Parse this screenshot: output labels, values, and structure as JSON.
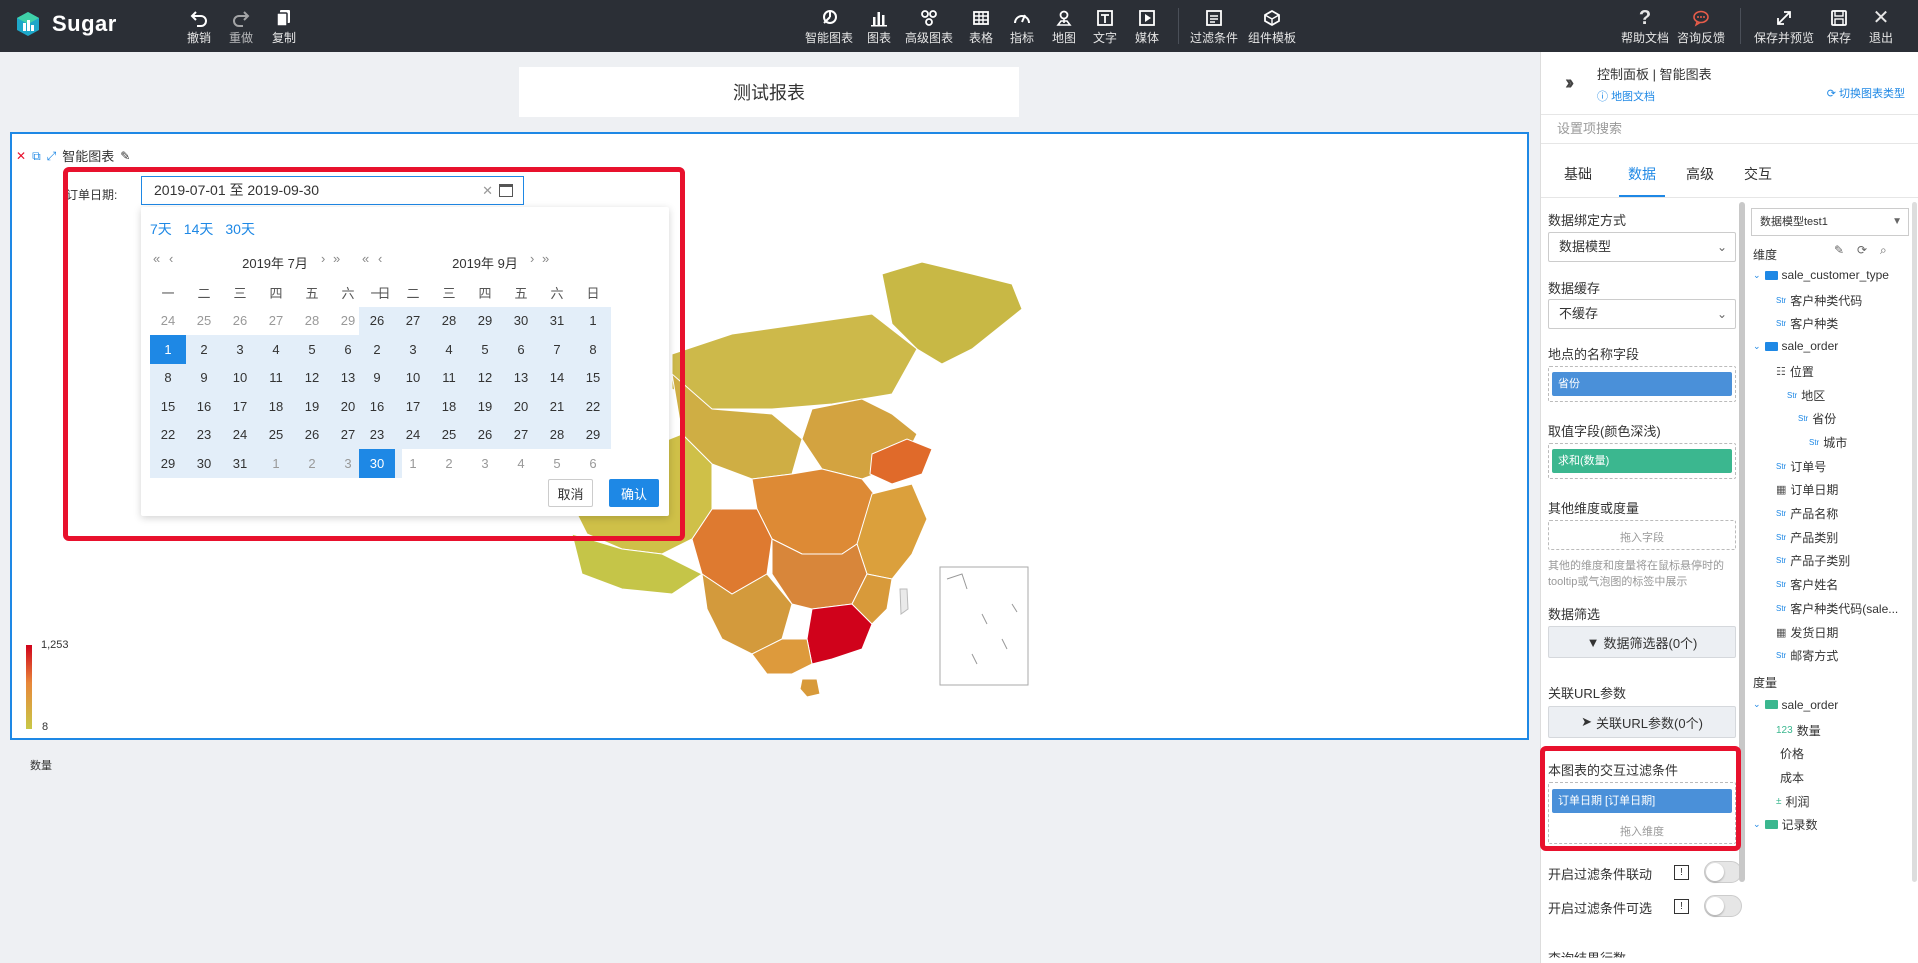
{
  "app": {
    "name": "Sugar"
  },
  "toolbar": {
    "left": [
      {
        "label": "撤销",
        "icon": "undo-icon"
      },
      {
        "label": "重做",
        "icon": "redo-icon"
      },
      {
        "label": "复制",
        "icon": "copy-icon"
      }
    ],
    "center": [
      {
        "label": "智能图表",
        "icon": "smart-chart-icon"
      },
      {
        "label": "图表",
        "icon": "bar-chart-icon"
      },
      {
        "label": "高级图表",
        "icon": "advanced-chart-icon"
      },
      {
        "label": "表格",
        "icon": "table-icon"
      },
      {
        "label": "指标",
        "icon": "gauge-icon"
      },
      {
        "label": "地图",
        "icon": "map-pin-icon"
      },
      {
        "label": "文字",
        "icon": "text-icon"
      },
      {
        "label": "媒体",
        "icon": "media-icon"
      },
      {
        "label": "过滤条件",
        "icon": "filter-condition-icon"
      },
      {
        "label": "组件模板",
        "icon": "component-template-icon"
      }
    ],
    "right": [
      {
        "label": "帮助文档",
        "icon": "help-icon"
      },
      {
        "label": "咨询反馈",
        "icon": "feedback-icon"
      },
      {
        "label": "保存并预览",
        "icon": "save-preview-icon"
      },
      {
        "label": "保存",
        "icon": "save-icon"
      },
      {
        "label": "退出",
        "icon": "close-icon"
      }
    ],
    "feedback_color": "#e85d4a"
  },
  "report": {
    "title": "测试报表"
  },
  "chart": {
    "name": "智能图表",
    "filter_label": "订单日期:",
    "date_value": "2019-07-01 至 2019-09-30",
    "clear_glyph": "✕",
    "legend": {
      "title": "数量",
      "max": "1,253",
      "min": "8"
    }
  },
  "datepicker": {
    "shortcuts": [
      "7天",
      "14天",
      "30天"
    ],
    "weekdays": [
      "一",
      "二",
      "三",
      "四",
      "五",
      "六",
      "日"
    ],
    "left": {
      "title": "2019年 7月",
      "days": [
        "24",
        "25",
        "26",
        "27",
        "28",
        "29",
        "30",
        "1",
        "2",
        "3",
        "4",
        "5",
        "6",
        "7",
        "8",
        "9",
        "10",
        "11",
        "12",
        "13",
        "14",
        "15",
        "16",
        "17",
        "18",
        "19",
        "20",
        "21",
        "22",
        "23",
        "24",
        "25",
        "26",
        "27",
        "28",
        "29",
        "30",
        "31",
        "1",
        "2",
        "3",
        "4"
      ]
    },
    "right": {
      "title": "2019年 9月",
      "days": [
        "26",
        "27",
        "28",
        "29",
        "30",
        "31",
        "1",
        "2",
        "3",
        "4",
        "5",
        "6",
        "7",
        "8",
        "9",
        "10",
        "11",
        "12",
        "13",
        "14",
        "15",
        "16",
        "17",
        "18",
        "19",
        "20",
        "21",
        "22",
        "23",
        "24",
        "25",
        "26",
        "27",
        "28",
        "29",
        "30",
        "1",
        "2",
        "3",
        "4",
        "5",
        "6"
      ]
    },
    "cancel": "取消",
    "confirm": "确认",
    "accent": "#1e88e5",
    "range_bg": "#e3eef9"
  },
  "panel": {
    "title": "控制面板 | 智能图表",
    "doc_link": "地图文档",
    "switch_link": "切换图表类型",
    "search_placeholder": "设置项搜索",
    "tabs": [
      "基础",
      "数据",
      "高级",
      "交互"
    ],
    "active_tab": "数据",
    "bind_mode_label": "数据绑定方式",
    "bind_mode_value": "数据模型",
    "cache_label": "数据缓存",
    "cache_value": "不缓存",
    "location_label": "地点的名称字段",
    "location_field": "省份",
    "value_label": "取值字段(颜色深浅)",
    "value_field": "求和(数量)",
    "other_label": "其他维度或度量",
    "drop_field": "拖入字段",
    "other_note": "其他的维度和度量将在鼠标悬停时的tooltip或气泡图的标签中展示",
    "filter_label": "数据筛选",
    "filter_button": "数据筛选器(0个)",
    "url_label": "关联URL参数",
    "url_button": "关联URL参数(0个)",
    "interact_label": "本图表的交互过滤条件",
    "interact_field": "订单日期 [订单日期]",
    "drop_dim": "拖入维度",
    "toggle1": "开启过滤条件联动",
    "toggle2": "开启过滤条件可选",
    "info_glyph": "!",
    "cut_label": "查询结果行数",
    "field_blue": "#4a90d9",
    "field_green": "#3bb78f"
  },
  "model": {
    "selected": "数据模型test1",
    "dim_label": "维度",
    "measure_label": "度量",
    "dimensions": [
      {
        "level": 0,
        "kind": "folder",
        "label": "sale_customer_type"
      },
      {
        "level": 1,
        "kind": "Str",
        "label": "客户种类代码"
      },
      {
        "level": 1,
        "kind": "Str",
        "label": "客户种类"
      },
      {
        "level": 0,
        "kind": "folder",
        "label": "sale_order"
      },
      {
        "level": 1,
        "kind": "hier",
        "label": "位置"
      },
      {
        "level": 2,
        "kind": "Str",
        "label": "地区"
      },
      {
        "level": 3,
        "kind": "Str",
        "label": "省份"
      },
      {
        "level": 4,
        "kind": "Str",
        "label": "城市"
      },
      {
        "level": 1,
        "kind": "Str",
        "label": "订单号"
      },
      {
        "level": 1,
        "kind": "date",
        "label": "订单日期"
      },
      {
        "level": 1,
        "kind": "Str",
        "label": "产品名称"
      },
      {
        "level": 1,
        "kind": "Str",
        "label": "产品类别"
      },
      {
        "level": 1,
        "kind": "Str",
        "label": "产品子类别"
      },
      {
        "level": 1,
        "kind": "Str",
        "label": "客户姓名"
      },
      {
        "level": 1,
        "kind": "Str",
        "label": "客户种类代码(sale..."
      },
      {
        "level": 1,
        "kind": "date",
        "label": "发货日期"
      },
      {
        "level": 1,
        "kind": "Str",
        "label": "邮寄方式"
      }
    ],
    "measures": [
      {
        "level": 0,
        "kind": "folder",
        "label": "sale_order"
      },
      {
        "level": 1,
        "kind": "123",
        "label": "数量"
      },
      {
        "level": 1,
        "kind": "0.5",
        "label": "价格"
      },
      {
        "level": 1,
        "kind": "0.5",
        "label": "成本"
      },
      {
        "level": 1,
        "kind": "calc",
        "label": "利润"
      },
      {
        "level": 0,
        "kind": "folder",
        "label": "记录数"
      }
    ],
    "tag_texts": {
      "Str": "Str",
      "123": "123",
      "0.5": "0.5",
      "calc": "±",
      "hier": "☷",
      "date": "▦"
    }
  }
}
